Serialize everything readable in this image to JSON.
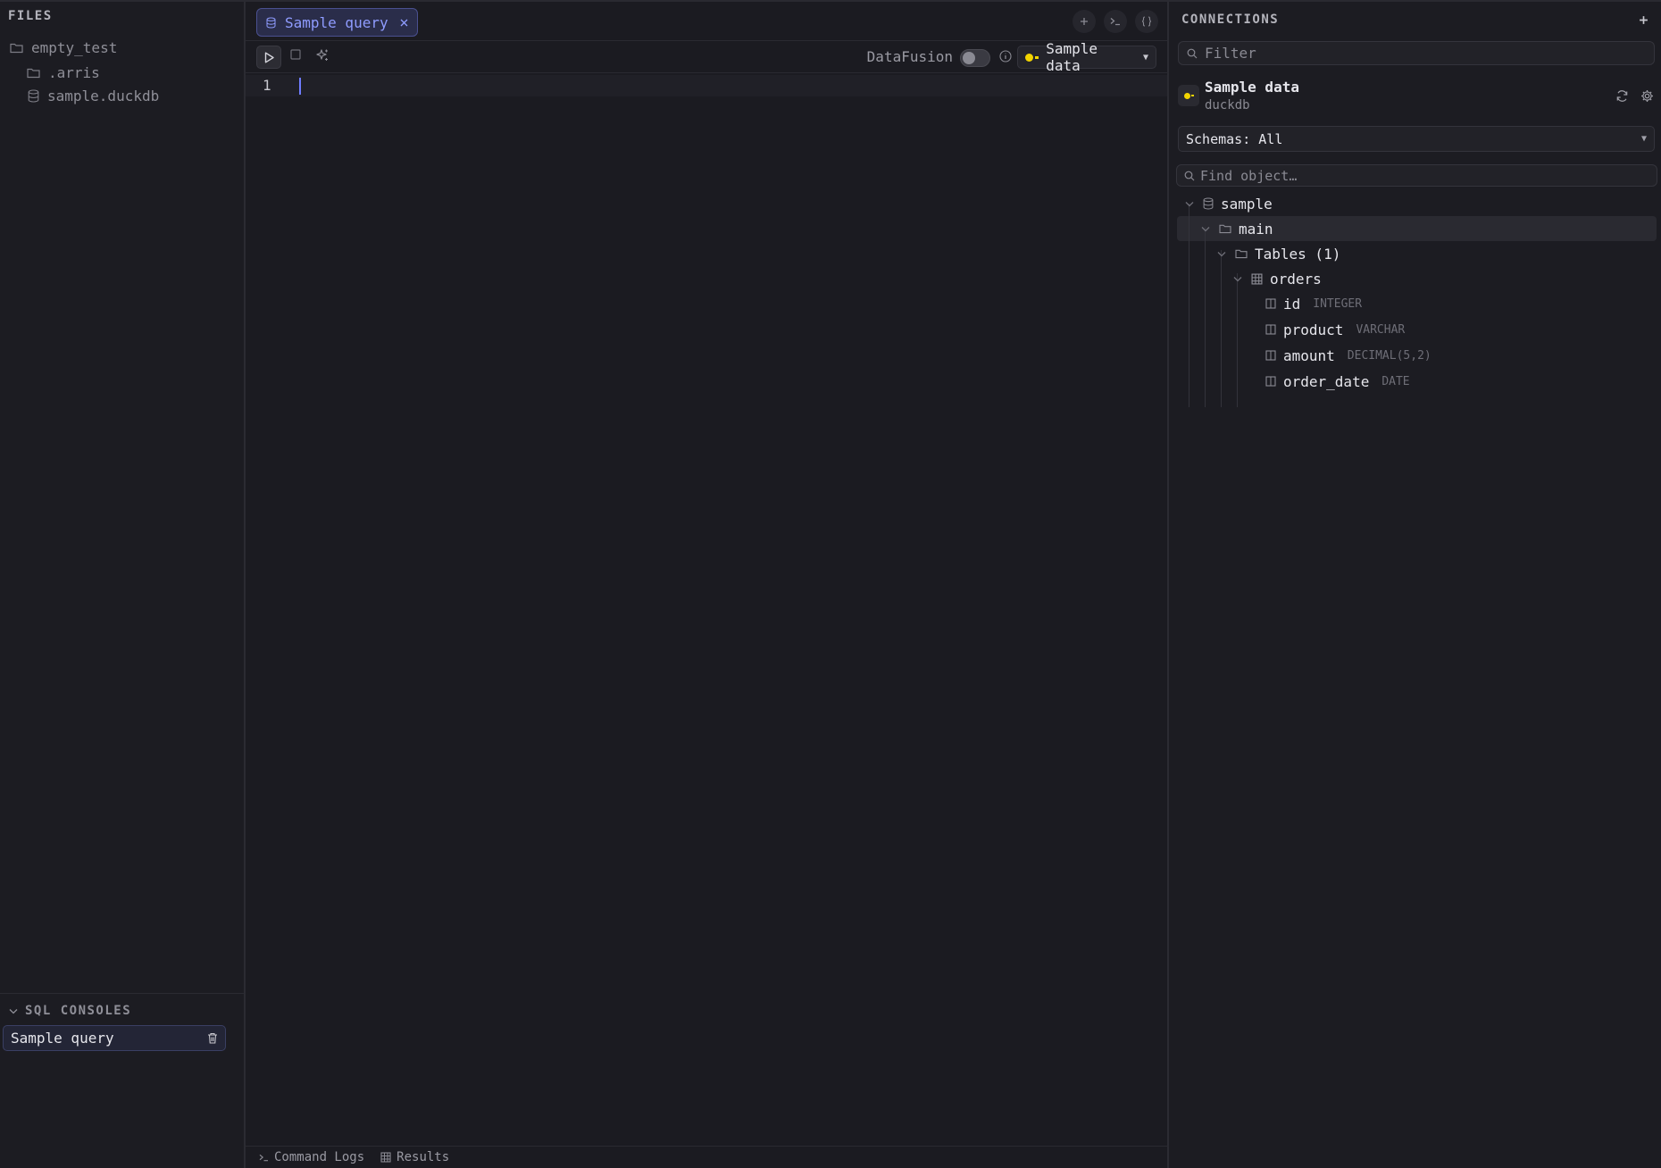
{
  "files": {
    "header": "FILES",
    "items": [
      {
        "name": "empty_test",
        "icon": "folder-icon"
      },
      {
        "name": ".arris",
        "icon": "folder-icon"
      },
      {
        "name": "sample.duckdb",
        "icon": "database-icon"
      }
    ]
  },
  "consoles": {
    "header": "SQL CONSOLES",
    "items": [
      {
        "label": "Sample query"
      }
    ]
  },
  "editor": {
    "tab_label": "Sample query",
    "engine_label": "DataFusion",
    "engine_enabled": false,
    "connection_label": "Sample data",
    "line_numbers": [
      "1"
    ],
    "code": ""
  },
  "bottom_tabs": [
    "Command Logs",
    "Results"
  ],
  "connections": {
    "header": "CONNECTIONS",
    "filter_placeholder": "Filter",
    "connection": {
      "name": "Sample data",
      "type": "duckdb",
      "status_color": "#f2d400"
    },
    "schema_select": "Schemas: All",
    "find_placeholder": "Find object…",
    "tree": {
      "database": "sample",
      "schema": "main",
      "tables_group": "Tables (1)",
      "table": "orders",
      "columns": [
        {
          "name": "id",
          "type": "INTEGER"
        },
        {
          "name": "product",
          "type": "VARCHAR"
        },
        {
          "name": "amount",
          "type": "DECIMAL(5,2)"
        },
        {
          "name": "order_date",
          "type": "DATE"
        }
      ]
    }
  },
  "colors": {
    "accent": "#8f9cff",
    "status": "#f2d400",
    "background": "#1b1b21"
  }
}
